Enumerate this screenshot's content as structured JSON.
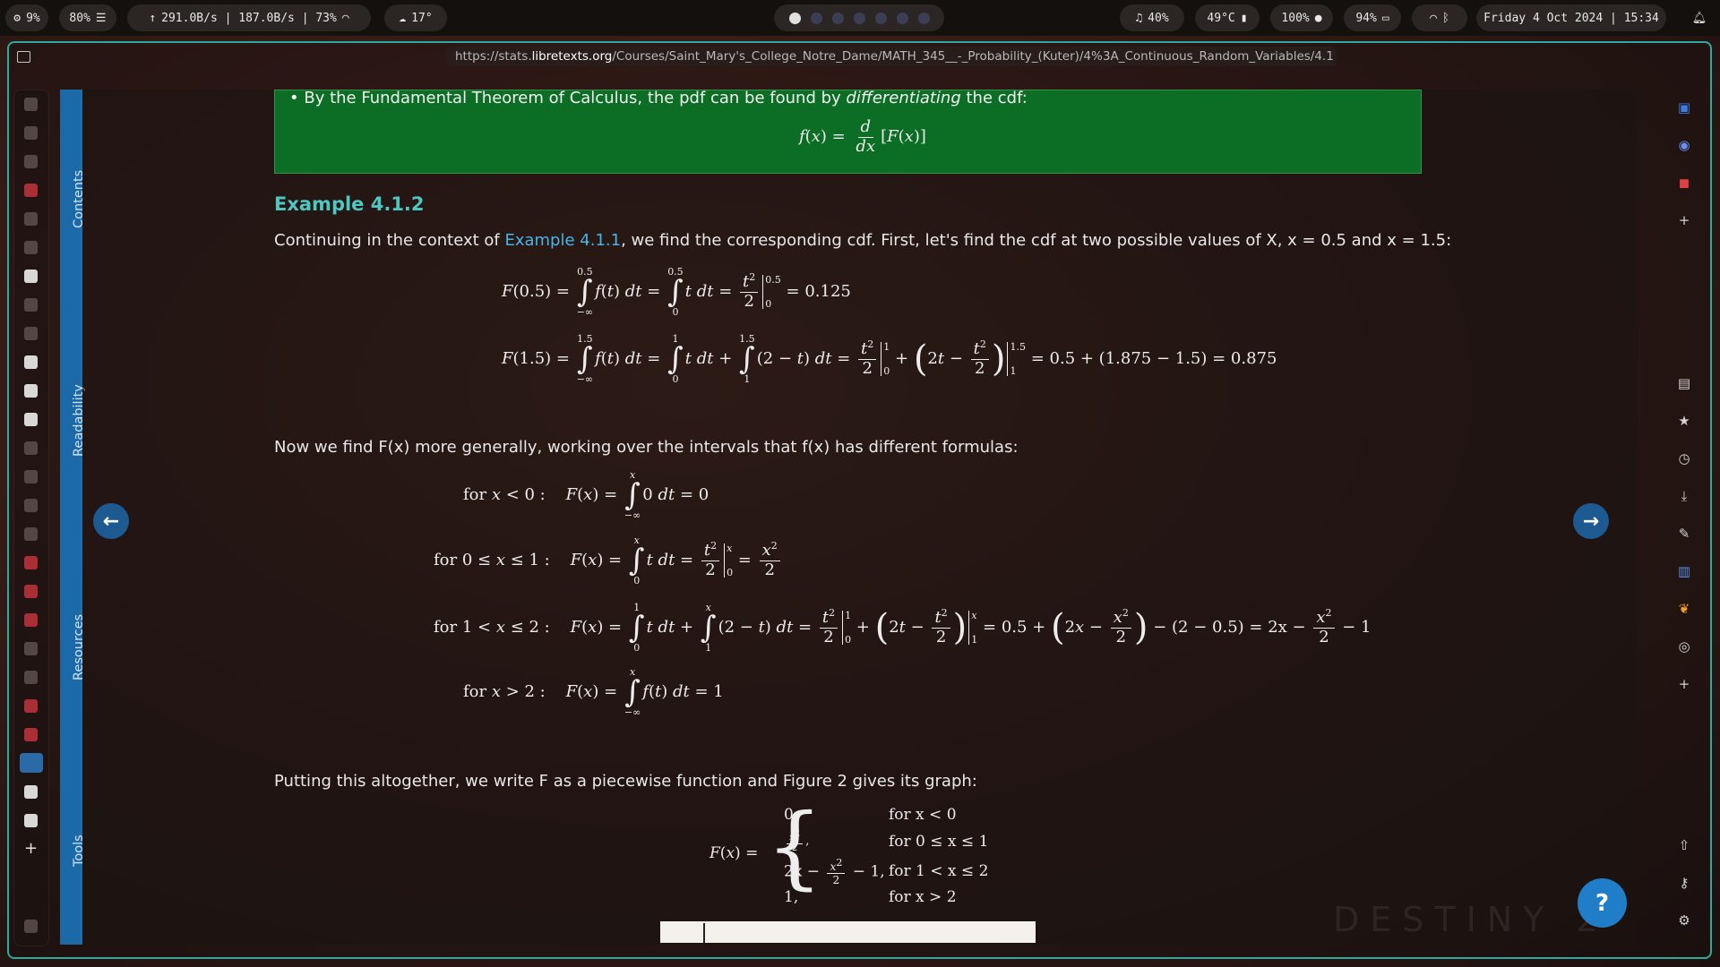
{
  "topbar": {
    "cpu": "9%",
    "brightness": "80%",
    "network": "291.0B/s | 187.0B/s | 73%",
    "weather": "17°",
    "volume": "40%",
    "temp": "49°C",
    "zoom": "100%",
    "battery": "94%",
    "datetime": "Friday  4 Oct 2024 | 15:34"
  },
  "browser": {
    "url_prefix": "https://stats.",
    "url_host": "libretexts.org",
    "url_path": "/Courses/Saint_Mary's_College_Notre_Dame/MATH_345__-_Probability_(Kuter)/4%3A_Continuous_Random_Variables/4.1"
  },
  "side_tabs": [
    "Contents",
    "Readability",
    "Resources",
    "Tools"
  ],
  "content": {
    "ftc_text_1": "By the Fundamental Theorem of Calculus, the pdf can be found by ",
    "ftc_italic": "differentiating",
    "ftc_text_2": " the cdf:",
    "example_title": "Example 4.1.2",
    "intro_1": "Continuing in the context of ",
    "intro_link": "Example 4.1.1",
    "intro_2": ", we find the corresponding cdf. First, let's find the cdf at two possible values of X, x = 0.5 and x = 1.5:",
    "general_text": "Now we find F(x) more generally, working over the intervals that f(x) has different formulas:",
    "piecewise_text": "Putting this altogether, we write F as a piecewise function and Figure 2 gives its graph:",
    "case_for_1": "for x < 0",
    "case_for_2": "for 0 ≤ x ≤ 1",
    "case_for_3": "for 1 < x ≤ 2",
    "case_for_4": "for x > 2",
    "case_val_1": "0,",
    "case_val_3a": "2x −",
    "case_val_3b": "− 1,",
    "case_val_4": "1,",
    "r1_res": "= 0.125",
    "r2_res": "= 0.5 + (1.875 − 1.5) = 0.875",
    "g3_res": "= 0.5 +",
    "g3_res2": "− (2 − 0.5) = 2x −",
    "g3_res3": "− 1"
  },
  "help_label": "?"
}
